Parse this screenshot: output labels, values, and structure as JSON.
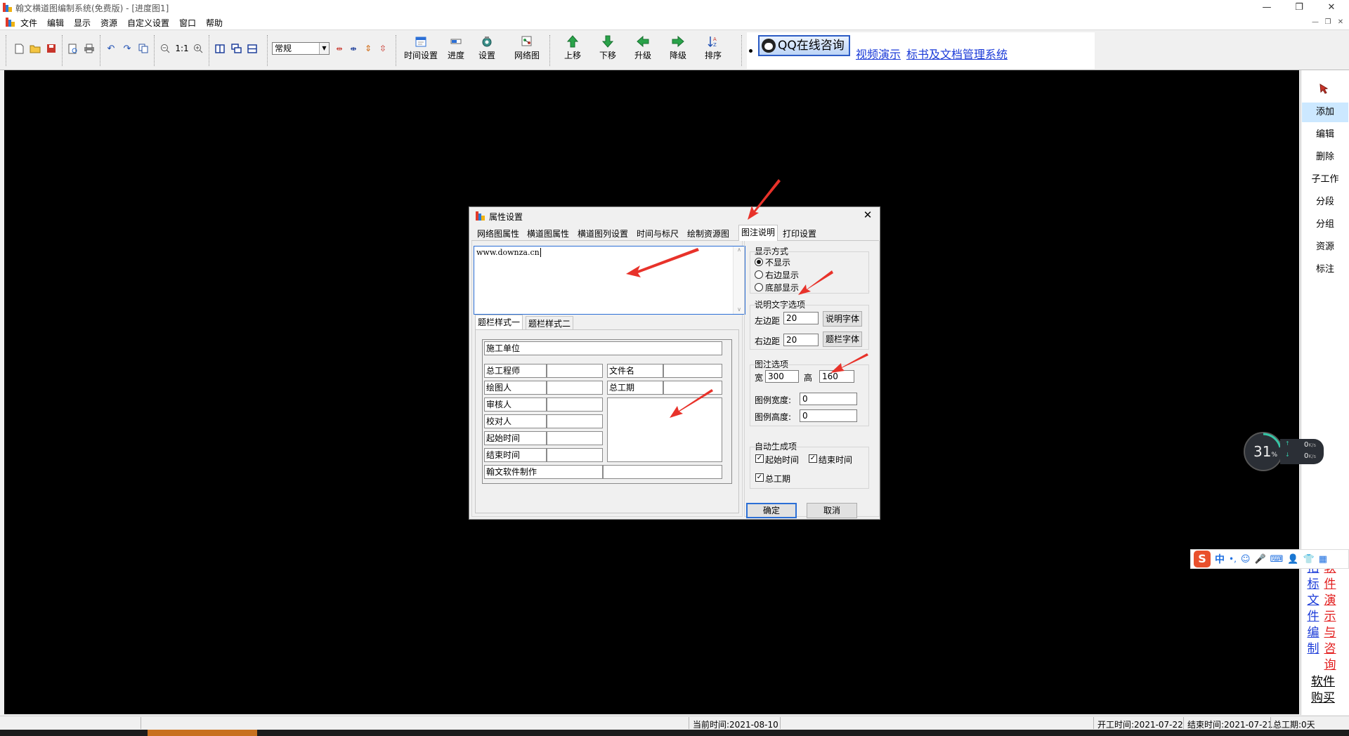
{
  "window": {
    "title": "翰文横道图编制系统(免费版) - [进度图1]",
    "min": "—",
    "restore": "❐",
    "close": "✕"
  },
  "menubar": {
    "items": [
      "文件",
      "编辑",
      "显示",
      "资源",
      "自定义设置",
      "窗口",
      "帮助"
    ],
    "mdi": [
      "—",
      "❐",
      "✕"
    ]
  },
  "toolbar": {
    "zoom_ratio": "1:1",
    "view_select": "常规",
    "big_buttons": [
      {
        "label": "时间设置",
        "icon": "calendar-icon"
      },
      {
        "label": "进度",
        "icon": "progress-icon"
      },
      {
        "label": "设置",
        "icon": "gear-icon"
      },
      {
        "label": "网络图",
        "icon": "network-icon"
      },
      {
        "label": "上移",
        "icon": "arrow-up-icon"
      },
      {
        "label": "下移",
        "icon": "arrow-down-icon"
      },
      {
        "label": "升级",
        "icon": "arrow-left-icon"
      },
      {
        "label": "降级",
        "icon": "arrow-right-icon"
      },
      {
        "label": "排序",
        "icon": "sort-icon"
      }
    ],
    "qq_button": "QQ在线咨询",
    "link_video": "视频演示",
    "link_docs": "标书及文档管理系统"
  },
  "right_panel": {
    "items": [
      "添加",
      "编辑",
      "删除",
      "子工作",
      "分段",
      "分组",
      "资源",
      "标注"
    ],
    "active": "添加",
    "vlink_blue": [
      "招",
      "标",
      "文",
      "件",
      "编",
      "制"
    ],
    "vlink_red": [
      "软",
      "件",
      "演",
      "示",
      "与",
      "咨",
      "询"
    ],
    "buy_line1": "软件",
    "buy_line2": "购买"
  },
  "netwidget": {
    "percent": "31",
    "unit": "%",
    "up": "0",
    "down": "0",
    "speed_unit": "K/s"
  },
  "statusbar": {
    "current_time": "当前时间:2021-08-10",
    "start_time": "开工时间:2021-07-22",
    "end_time": "结束时间:2021-07-21",
    "total_period": "总工期:0天"
  },
  "dialog": {
    "title": "属性设置",
    "tabs": [
      "网络图属性",
      "横道图属性",
      "横道图列设置",
      "时间与标尺",
      "绘制资源图",
      "图注说明",
      "打印设置"
    ],
    "active_tab": "图注说明",
    "text_area": "www.downza.cn",
    "subtabs": [
      "题栏样式一",
      "题栏样式二"
    ],
    "table": {
      "unit": "施工单位",
      "left_labels": [
        "总工程师",
        "绘图人",
        "审核人",
        "校对人",
        "起始时间",
        "结束时间"
      ],
      "right_labels": [
        "文件名",
        "总工期"
      ],
      "footer": "翰文软件制作"
    },
    "display_mode": {
      "label": "显示方式",
      "options": [
        "不显示",
        "右边显示",
        "底部显示"
      ],
      "selected": "不显示"
    },
    "text_options": {
      "label": "说明文字选项",
      "left_margin_label": "左边距",
      "left_margin": "20",
      "right_margin_label": "右边距",
      "right_margin": "20",
      "font_button": "说明字体",
      "title_font_button": "题栏字体"
    },
    "legend_options": {
      "label": "图注选项",
      "width_label": "宽",
      "width": "300",
      "height_label": "高",
      "height": "160",
      "legend_width_label": "图例宽度:",
      "legend_width": "0",
      "legend_height_label": "图例高度:",
      "legend_height": "0"
    },
    "auto_items": {
      "label": "自动生成项",
      "start": "起始时间",
      "end": "结束时间",
      "total": "总工期",
      "checked": [
        true,
        true,
        true
      ]
    },
    "ok": "确定",
    "cancel": "取消"
  },
  "colors": {
    "canvas": "#000000",
    "link_blue": "#1a3ad8",
    "link_red": "#e21b1b",
    "arrow_red": "#e8322a"
  }
}
